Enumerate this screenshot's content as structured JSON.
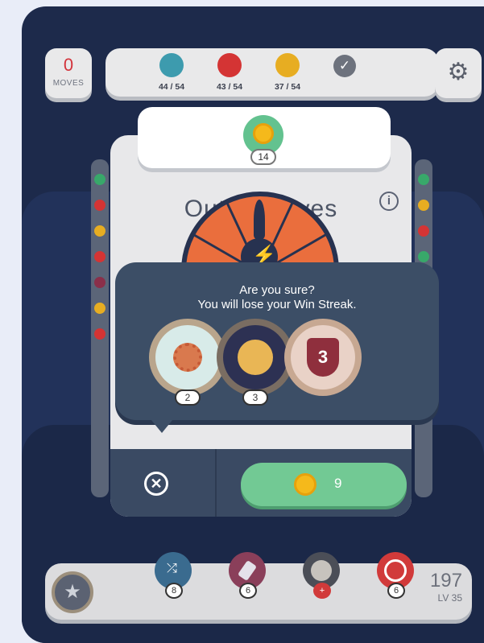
{
  "moves": {
    "value": "0",
    "label": "MOVES"
  },
  "goals": [
    {
      "color": "#3d9bae",
      "count": "44 / 54"
    },
    {
      "color": "#d43434",
      "count": "43 / 54"
    },
    {
      "color": "#e7ad22",
      "count": "37 / 54"
    }
  ],
  "completed_goal_icon": "checkmark-icon",
  "settings_icon": "gear-icon",
  "coin_card": {
    "count": "14"
  },
  "panel": {
    "title": "Out of Moves",
    "info_icon": "info-icon"
  },
  "confirm": {
    "line1": "Are you sure?",
    "line2": "You will lose your Win Streak.",
    "badges": [
      {
        "name": "sun-badge",
        "count": "2",
        "color": "#d8ebe9"
      },
      {
        "name": "planet-badge",
        "count": "3",
        "color": "#2d3153"
      },
      {
        "name": "shield-badge",
        "count": "",
        "label": "3",
        "color": "#e9d2c7"
      }
    ]
  },
  "footer": {
    "close_icon": "close-icon",
    "buy_price": "9"
  },
  "boosters": [
    {
      "name": "shuffle-booster",
      "count": "8",
      "color": "#3a6b8f"
    },
    {
      "name": "eraser-booster",
      "count": "6",
      "color": "#8a3f5a"
    },
    {
      "name": "bomb-booster",
      "count": "+",
      "color": "#4b4e57"
    },
    {
      "name": "target-booster",
      "count": "6",
      "color": "#d13a3a"
    }
  ],
  "score": {
    "value": "197",
    "level": "LV 35"
  }
}
